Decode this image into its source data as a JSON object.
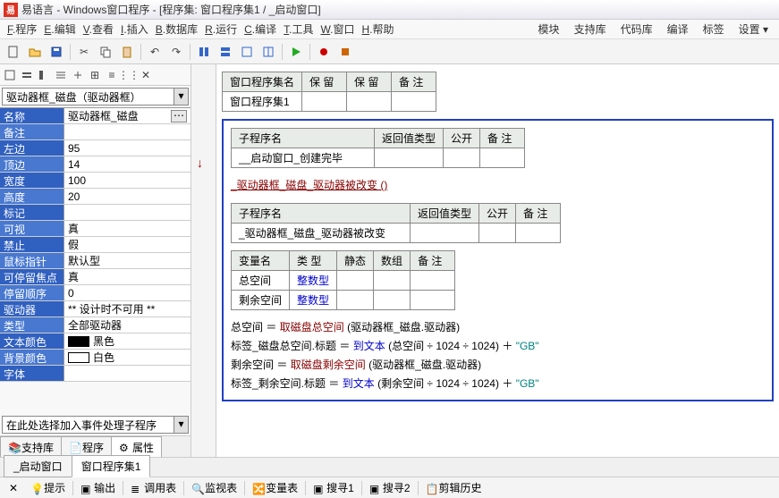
{
  "title": "易语言 - Windows窗口程序 - [程序集: 窗口程序集1 / _启动窗口]",
  "menubar": {
    "items": [
      {
        "key": "F",
        "label": "程序"
      },
      {
        "key": "E",
        "label": "编辑"
      },
      {
        "key": "V",
        "label": "查看"
      },
      {
        "key": "I",
        "label": "插入"
      },
      {
        "key": "B",
        "label": "数据库"
      },
      {
        "key": "R",
        "label": "运行"
      },
      {
        "key": "C",
        "label": "编译"
      },
      {
        "key": "T",
        "label": "工具"
      },
      {
        "key": "W",
        "label": "窗口"
      },
      {
        "key": "H",
        "label": "帮助"
      }
    ],
    "right": [
      "模块",
      "支持库",
      "代码库",
      "编译",
      "标签",
      "设置"
    ]
  },
  "combo_selected": "驱动器框_磁盘（驱动器框）",
  "props": [
    {
      "name": "名称",
      "value": "驱动器框_磁盘",
      "btn": true,
      "alt": false
    },
    {
      "name": "备注",
      "value": "",
      "alt": true
    },
    {
      "name": "左边",
      "value": "95",
      "alt": false
    },
    {
      "name": "顶边",
      "value": "14",
      "alt": true
    },
    {
      "name": "宽度",
      "value": "100",
      "alt": false
    },
    {
      "name": "高度",
      "value": "20",
      "alt": true
    },
    {
      "name": "标记",
      "value": "",
      "alt": false
    },
    {
      "name": "可视",
      "value": "真",
      "alt": true
    },
    {
      "name": "禁止",
      "value": "假",
      "alt": false
    },
    {
      "name": "鼠标指针",
      "value": "默认型",
      "alt": true
    },
    {
      "name": "可停留焦点",
      "value": "真",
      "alt": false
    },
    {
      "name": "  停留顺序",
      "value": "0",
      "alt": true
    },
    {
      "name": "驱动器",
      "value": "** 设计时不可用 **",
      "alt": false
    },
    {
      "name": "类型",
      "value": "全部驱动器",
      "alt": true
    },
    {
      "name": "文本颜色",
      "value": "黑色",
      "color": "#000000",
      "alt": false
    },
    {
      "name": "背景颜色",
      "value": "白色",
      "color": "#ffffff",
      "alt": true
    },
    {
      "name": "字体",
      "value": "",
      "alt": false
    }
  ],
  "event_placeholder": "在此处选择加入事件处理子程序",
  "left_tabs": [
    "支持库",
    "程序",
    "属性"
  ],
  "top_table": {
    "headers": [
      "窗口程序集名",
      "保 留",
      "保 留",
      "备 注"
    ],
    "row": [
      "窗口程序集1",
      "",
      "",
      ""
    ]
  },
  "sub1": {
    "headers": [
      "子程序名",
      "返回值类型",
      "公开",
      "备 注"
    ],
    "row": [
      "__启动窗口_创建完毕",
      "",
      "",
      ""
    ]
  },
  "call_line": "_驱动器框_磁盘_驱动器被改变 ()",
  "sub2": {
    "headers": [
      "子程序名",
      "返回值类型",
      "公开",
      "备 注"
    ],
    "row": [
      "_驱动器框_磁盘_驱动器被改变",
      "",
      "",
      ""
    ]
  },
  "vars": {
    "headers": [
      "变量名",
      "类 型",
      "静态",
      "数组",
      "备 注"
    ],
    "rows": [
      {
        "name": "总空间",
        "type": "整数型"
      },
      {
        "name": "剩余空间",
        "type": "整数型"
      }
    ]
  },
  "code": {
    "l1": {
      "lhs": "总空间",
      "eq": "＝",
      "fn": "取磁盘总空间",
      "args": "(驱动器框_磁盘.驱动器)"
    },
    "l2": {
      "lhs": "标签_磁盘总空间.标题",
      "eq": "＝",
      "fn": "到文本",
      "args": "(总空间 ÷ 1024 ÷ 1024)",
      "plus": "＋",
      "str": "\"GB\""
    },
    "l3": {
      "lhs": "剩余空间",
      "eq": "＝",
      "fn": "取磁盘剩余空间",
      "args": "(驱动器框_磁盘.驱动器)"
    },
    "l4": {
      "lhs": "标签_剩余空间.标题",
      "eq": "＝",
      "fn": "到文本",
      "args": "(剩余空间 ÷ 1024 ÷ 1024)",
      "plus": "＋",
      "str": "\"GB\""
    }
  },
  "bottom_tabs": [
    "_启动窗口",
    "窗口程序集1"
  ],
  "statusbar": [
    "提示",
    "输出",
    "调用表",
    "监视表",
    "变量表",
    "搜寻1",
    "搜寻2",
    "剪辑历史"
  ]
}
